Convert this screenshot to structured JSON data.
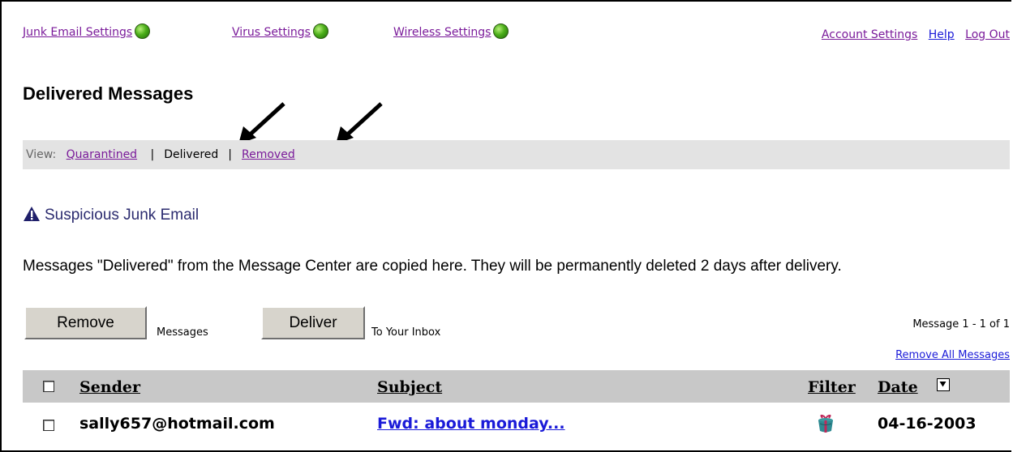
{
  "top_nav": [
    {
      "label": "Junk Email Settings",
      "status": "green"
    },
    {
      "label": "Virus Settings",
      "status": "green"
    },
    {
      "label": "Wireless Settings",
      "status": "green"
    }
  ],
  "top_links": {
    "account": "Account Settings",
    "help": "Help",
    "logout": "Log Out"
  },
  "page_title": "Delivered Messages",
  "view_bar": {
    "label": "View:",
    "quarantined": "Quarantined",
    "delivered": "Delivered",
    "removed": "Removed",
    "separator": "|"
  },
  "warning": "Suspicious Junk Email",
  "description": "Messages \"Delivered\" from the Message Center are copied here. They will be permanently deleted 2 days after delivery.",
  "actions": {
    "remove_label": "Remove",
    "remove_note": "Messages",
    "deliver_label": "Deliver",
    "deliver_note": "To Your Inbox"
  },
  "message_count": "Message 1 - 1 of 1",
  "remove_all": "Remove All Messages",
  "table": {
    "columns": {
      "sender": "Sender",
      "subject": "Subject",
      "filter": "Filter",
      "date": "Date"
    },
    "rows": [
      {
        "sender": "sally657@hotmail.com",
        "subject": "Fwd: about monday...",
        "filter": "gift-icon",
        "date": "04-16-2003"
      }
    ]
  },
  "colors": {
    "visited_link": "#7a1a9a",
    "link": "#1a1ad8",
    "status_green": "#4caf1a",
    "header_bg": "#c8c8c8"
  }
}
